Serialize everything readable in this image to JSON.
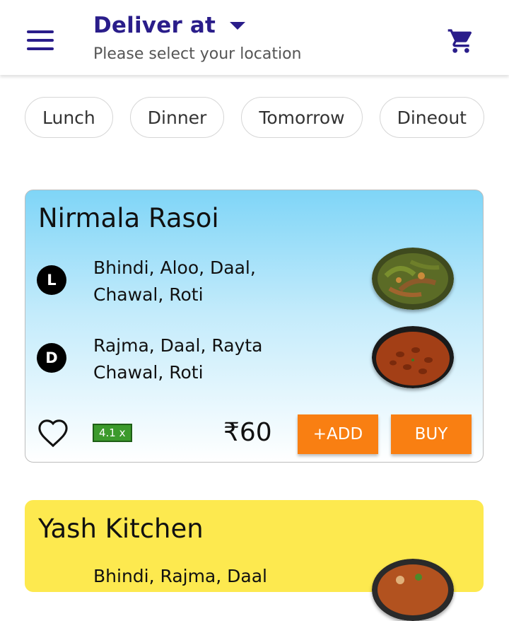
{
  "header": {
    "title": "Deliver at",
    "subtitle": "Please select your location",
    "accent_color": "#2a1d8a"
  },
  "chips": [
    "Lunch",
    "Dinner",
    "Tomorrow",
    "Dineout"
  ],
  "cards": [
    {
      "name": "Nirmala Rasoi",
      "meals": [
        {
          "badge": "L",
          "line1": "Bhindi, Aloo, Daal,",
          "line2": "Chawal, Roti",
          "image_icon": "bhindi-dish-image"
        },
        {
          "badge": "D",
          "line1": "Rajma, Daal, Rayta",
          "line2": "Chawal, Roti",
          "image_icon": "rajma-dish-image"
        }
      ],
      "rating": "4.1 x",
      "price": "₹60",
      "add_label": "+ADD",
      "buy_label": "BUY"
    },
    {
      "name": "Yash Kitchen",
      "partial_meal": "Bhindi, Rajma, Daal"
    }
  ],
  "colors": {
    "button": "#f97f12",
    "card1_top": "#7fd5f7",
    "card2": "#fde94f",
    "rating": "#3c9a2c"
  }
}
